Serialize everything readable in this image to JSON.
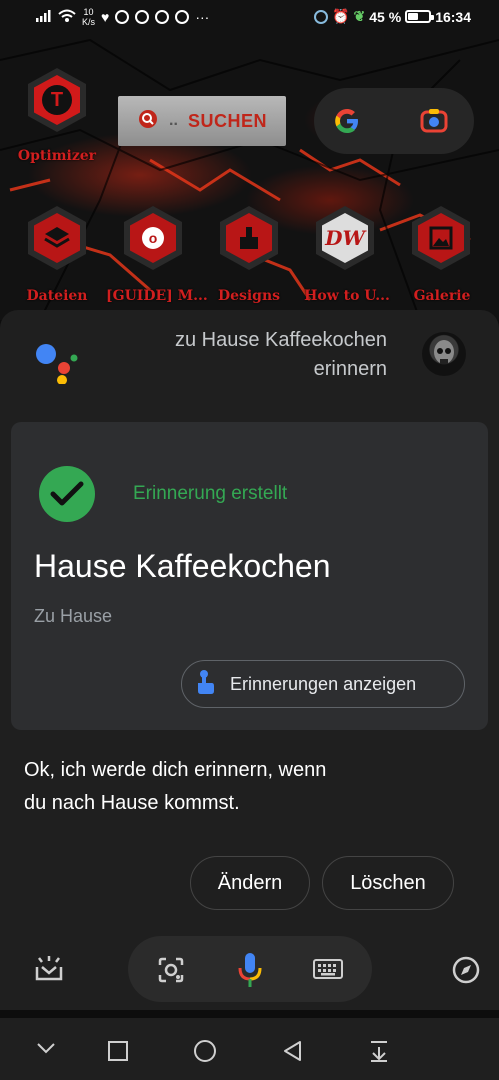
{
  "status_bar": {
    "speed_value": "10",
    "speed_unit": "K/s",
    "more": "···",
    "battery_percent": "45 %",
    "battery_level": 0.45,
    "time": "16:34"
  },
  "home": {
    "search_widget_label": "SUCHEN",
    "apps": [
      {
        "label": "Optimizer",
        "glyph": "T",
        "icon": "optimizer-icon"
      },
      {
        "label": "Dateien",
        "glyph": "",
        "icon": "layers-icon"
      },
      {
        "label": "[GUIDE] M...",
        "glyph": "o",
        "icon": "guide-icon"
      },
      {
        "label": "Designs",
        "glyph": "",
        "icon": "paint-brush-icon"
      },
      {
        "label": "How to U...",
        "glyph": "DW",
        "icon": "dw-icon"
      },
      {
        "label": "Galerie",
        "glyph": "",
        "icon": "gallery-icon"
      }
    ]
  },
  "assistant": {
    "query_line1": "zu Hause Kaffeekochen",
    "query_line2": "erinnern",
    "card": {
      "status": "Erinnerung erstellt",
      "title": "Hause Kaffeekochen",
      "location": "Zu Hause",
      "chip_label": "Erinnerungen anzeigen"
    },
    "reply_line1": "Ok, ich werde dich erinnern, wenn",
    "reply_line2": "du nach Hause kommst.",
    "buttons": {
      "change": "Ändern",
      "delete": "Löschen"
    }
  },
  "colors": {
    "accent_green": "#34a853",
    "sheet_bg": "#1f1f1f",
    "card_bg": "#2d2e30",
    "app_label_red": "#d11f1f"
  }
}
